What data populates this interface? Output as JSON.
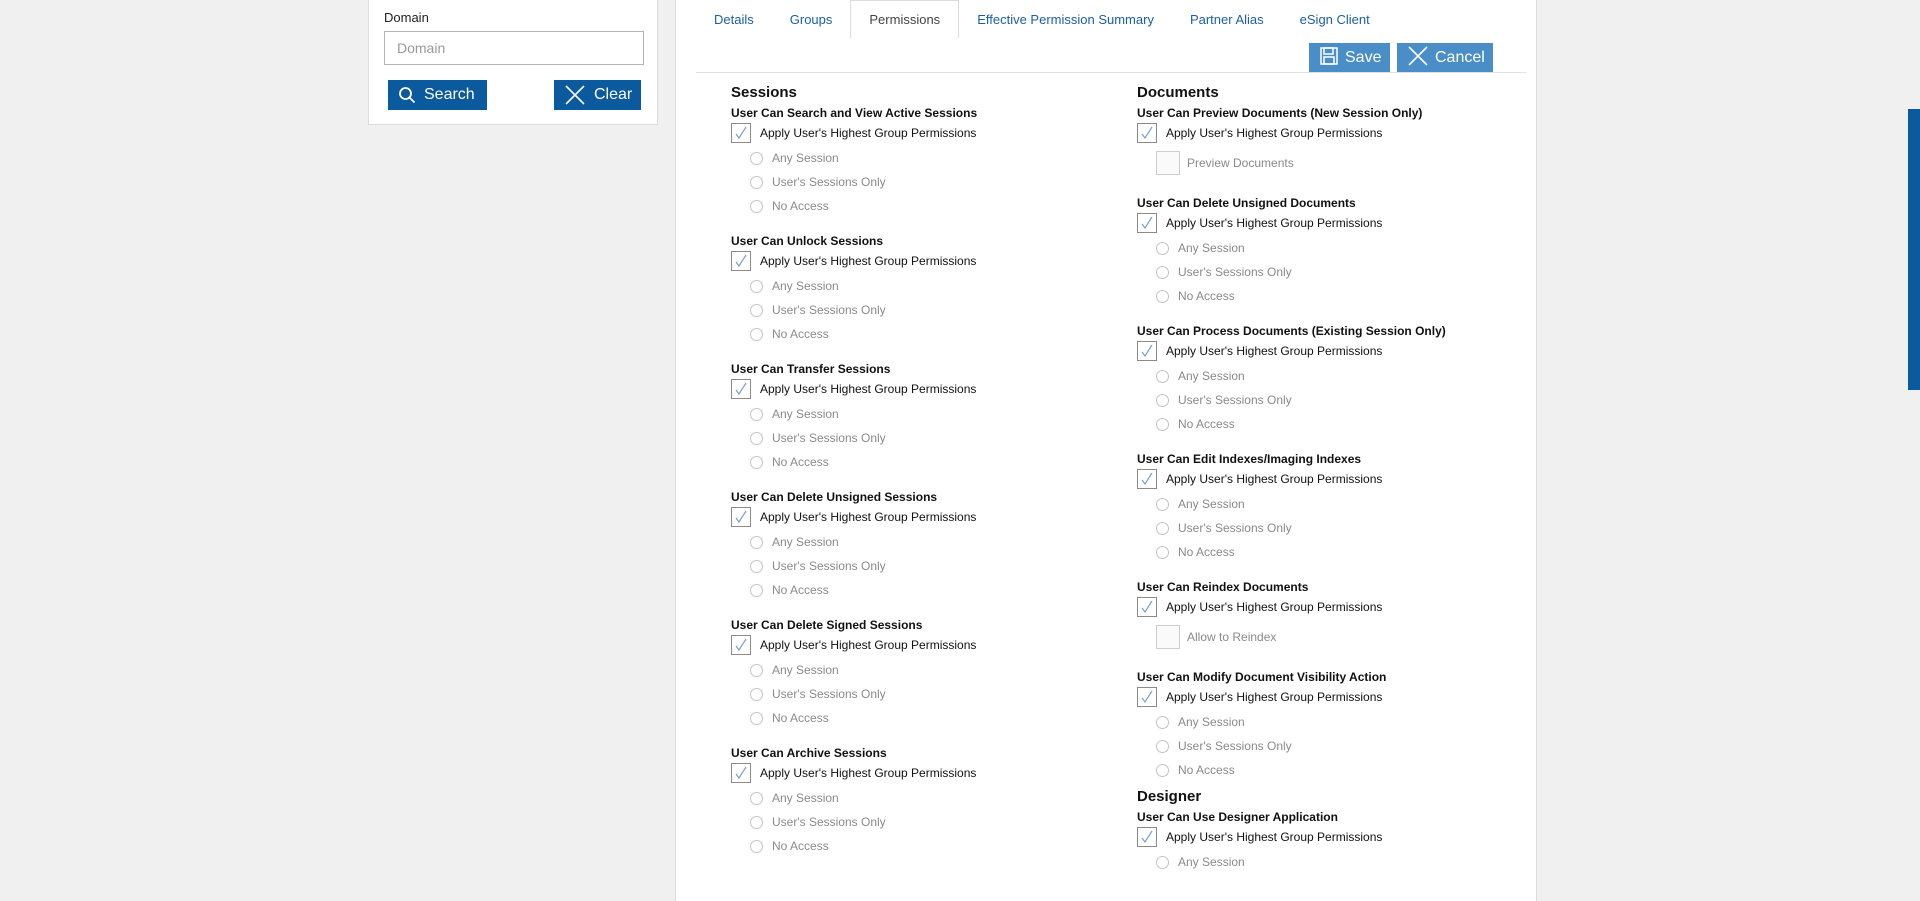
{
  "search_panel": {
    "domain_label": "Domain",
    "domain_placeholder": "Domain",
    "domain_value": "",
    "search_label": "Search",
    "clear_label": "Clear"
  },
  "tabs": [
    {
      "label": "Details",
      "active": false
    },
    {
      "label": "Groups",
      "active": false
    },
    {
      "label": "Permissions",
      "active": true
    },
    {
      "label": "Effective Permission Summary",
      "active": false
    },
    {
      "label": "Partner Alias",
      "active": false
    },
    {
      "label": "eSign Client",
      "active": false
    }
  ],
  "actions": {
    "save_label": "Save",
    "cancel_label": "Cancel"
  },
  "apply_label": "Apply User's Highest Group Permissions",
  "options": {
    "any": "Any Session",
    "own": "User's Sessions Only",
    "none": "No Access"
  },
  "sessions": {
    "title": "Sessions",
    "perms": [
      {
        "title": "User Can Search and View Active Sessions",
        "apply_checked": true
      },
      {
        "title": "User Can Unlock Sessions",
        "apply_checked": true
      },
      {
        "title": "User Can Transfer Sessions",
        "apply_checked": true
      },
      {
        "title": "User Can Delete Unsigned Sessions",
        "apply_checked": true
      },
      {
        "title": "User Can Delete Signed Sessions",
        "apply_checked": true
      },
      {
        "title": "User Can Archive Sessions",
        "apply_checked": true
      }
    ]
  },
  "documents": {
    "title": "Documents",
    "perms": [
      {
        "title": "User Can Preview Documents (New Session Only)",
        "apply_checked": true,
        "sub_checkbox": "Preview Documents"
      },
      {
        "title": "User Can Delete Unsigned Documents",
        "apply_checked": true
      },
      {
        "title": "User Can Process Documents (Existing Session Only)",
        "apply_checked": true
      },
      {
        "title": "User Can Edit Indexes/Imaging Indexes",
        "apply_checked": true
      },
      {
        "title": "User Can Reindex Documents",
        "apply_checked": true,
        "sub_checkbox": "Allow to Reindex"
      },
      {
        "title": "User Can Modify Document Visibility Action",
        "apply_checked": true
      }
    ]
  },
  "designer": {
    "title": "Designer",
    "perms": [
      {
        "title": "User Can Use Designer Application",
        "apply_checked": true
      }
    ],
    "visible_option": "Any Session"
  },
  "colors": {
    "primary_button": "#0b5a9d",
    "action_button": "#4a8ec7",
    "tab_link": "#1d5fa5",
    "scrollbar": "#0b5a9d"
  }
}
